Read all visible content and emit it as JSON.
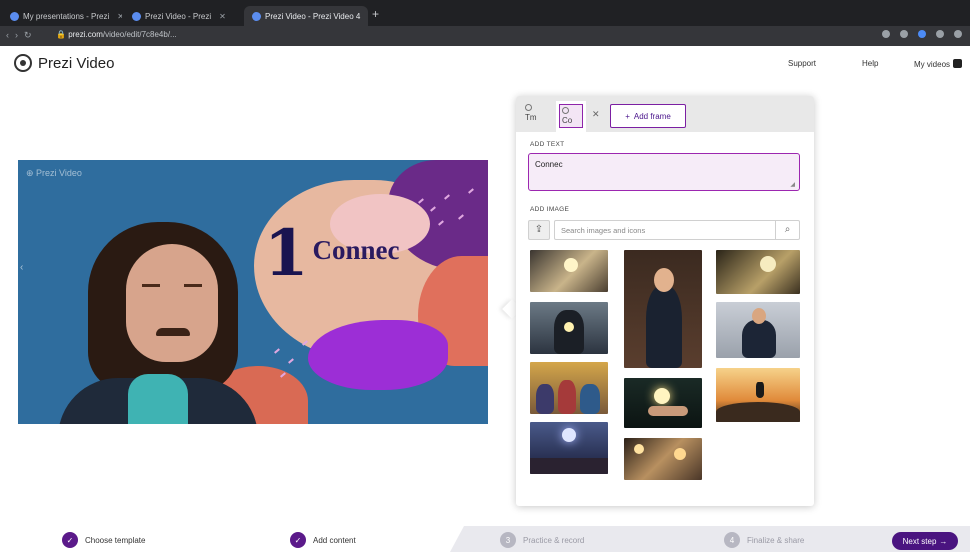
{
  "browser": {
    "tabs": [
      {
        "title": "My presentations - Prezi",
        "active": false
      },
      {
        "title": "Prezi Video - Prezi",
        "active": false
      },
      {
        "title": "Prezi Video - Prezi Video 4",
        "active": true
      }
    ],
    "url_host": "prezi.com",
    "url_path": "/video/edit/7c8e4b/..."
  },
  "header": {
    "logo_text": "Prezi Video",
    "support_label": "Support",
    "help_label": "Help",
    "my_videos_label": "My videos"
  },
  "preview": {
    "watermark": "Prezi Video",
    "headline_number": "1",
    "headline_text": "Connec"
  },
  "panel": {
    "frame_tabs": [
      {
        "label": "Tm",
        "selected": false
      },
      {
        "label": "Co",
        "selected": true
      }
    ],
    "add_frame_label": "Add frame",
    "add_text_label": "ADD TEXT",
    "text_value": "Connec",
    "add_image_label": "ADD IMAGE",
    "search_placeholder": "Search images and icons",
    "images": [
      {
        "name": "image-sparkler-bottle",
        "subject": "sparkler and bottle"
      },
      {
        "name": "image-businesswoman",
        "subject": "businesswoman standing"
      },
      {
        "name": "image-champagne",
        "subject": "champagne toast"
      },
      {
        "name": "image-hands-light",
        "subject": "businessman holding light"
      },
      {
        "name": "image-businessman-arms-crossed",
        "subject": "businessman arms crossed"
      },
      {
        "name": "image-cheering-crowd",
        "subject": "cheering group"
      },
      {
        "name": "image-hand-glow",
        "subject": "hand with glowing light"
      },
      {
        "name": "image-mountain-jump",
        "subject": "person jumping on hilltop"
      },
      {
        "name": "image-stage-lights",
        "subject": "stage with spotlights"
      },
      {
        "name": "image-party-bokeh",
        "subject": "party with bokeh lights"
      }
    ]
  },
  "stepper": {
    "steps": [
      {
        "number": "1",
        "label": "Choose template",
        "state": "done"
      },
      {
        "number": "2",
        "label": "Add content",
        "state": "done"
      },
      {
        "number": "3",
        "label": "Practice & record",
        "state": "todo"
      },
      {
        "number": "4",
        "label": "Finalize & share",
        "state": "todo"
      }
    ],
    "next_label": "Next step"
  },
  "colors": {
    "brand_purple": "#4a1480",
    "accent_purple": "#9c27b0",
    "video_background": "#2f6d9e",
    "headline_navy": "#1a1450"
  }
}
